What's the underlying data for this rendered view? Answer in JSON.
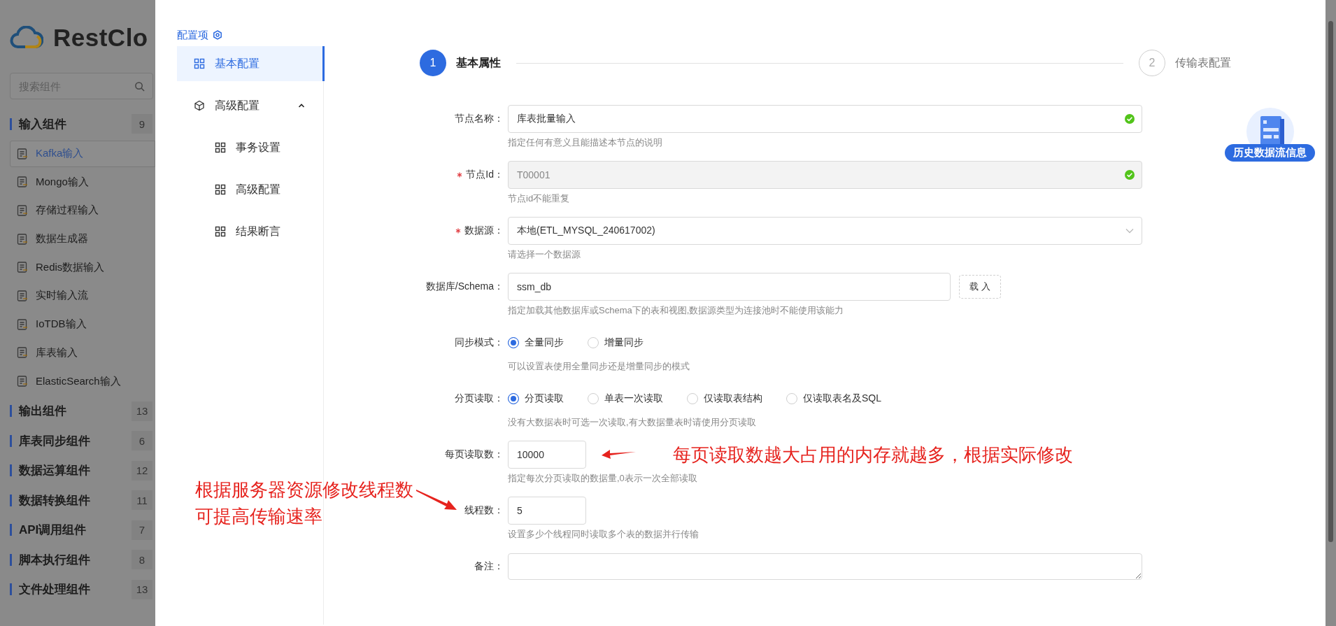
{
  "sidebar": {
    "logo": "RestClo",
    "search": {
      "placeholder": "搜索组件"
    },
    "categories": [
      {
        "label": "输入组件",
        "count": "9",
        "items": [
          {
            "label": "Kafka输入",
            "selected": true
          },
          {
            "label": "Mongo输入",
            "selected": false
          },
          {
            "label": "存储过程输入",
            "selected": false
          },
          {
            "label": "数据生成器",
            "selected": false
          },
          {
            "label": "Redis数据输入",
            "selected": false
          },
          {
            "label": "实时输入流",
            "selected": false
          },
          {
            "label": "IoTDB输入",
            "selected": false
          },
          {
            "label": "库表输入",
            "selected": false
          },
          {
            "label": "ElasticSearch输入",
            "selected": false
          }
        ]
      },
      {
        "label": "输出组件",
        "count": "13"
      },
      {
        "label": "库表同步组件",
        "count": "6"
      },
      {
        "label": "数据运算组件",
        "count": "12"
      },
      {
        "label": "数据转换组件",
        "count": "11"
      },
      {
        "label": "API调用组件",
        "count": "7"
      },
      {
        "label": "脚本执行组件",
        "count": "8"
      },
      {
        "label": "文件处理组件",
        "count": "13"
      }
    ]
  },
  "config_nav": {
    "title": "配置项",
    "items": [
      {
        "label": "基本配置",
        "selected": true
      },
      {
        "label": "高级配置",
        "selected": false,
        "expanded": true,
        "children": [
          {
            "label": "事务设置",
            "selected": false
          },
          {
            "label": "高级配置",
            "selected": false
          },
          {
            "label": "结果断言",
            "selected": false
          }
        ]
      }
    ]
  },
  "steps": [
    {
      "number": "1",
      "label": "基本属性",
      "active": true
    },
    {
      "number": "2",
      "label": "传输表配置",
      "active": false
    }
  ],
  "form": [
    {
      "kind": "text",
      "label": "节点名称：",
      "value": "库表批量输入",
      "valid": true,
      "disabled": false,
      "help": "指定任何有意义且能描述本节点的说明"
    },
    {
      "kind": "text",
      "label": "节点Id：",
      "required": true,
      "value": "T00001",
      "valid": true,
      "disabled": true,
      "help": "节点id不能重复"
    },
    {
      "kind": "select",
      "label": "数据源：",
      "required": true,
      "value": "本地(ETL_MYSQL_240617002)",
      "help": "请选择一个数据源"
    },
    {
      "kind": "text",
      "label": "数据库/Schema：",
      "value": "ssm_db",
      "disabled": false,
      "button": "载 入",
      "help": "指定加载其他数据库或Schema下的表和视图,数据源类型为连接池时不能使用该能力"
    },
    {
      "kind": "radio",
      "label": "同步模式：",
      "options": [
        {
          "label": "全量同步",
          "selected": true
        },
        {
          "label": "增量同步",
          "selected": false
        }
      ],
      "help": "可以设置表使用全量同步还是增量同步的模式"
    },
    {
      "kind": "radio",
      "label": "分页读取：",
      "options": [
        {
          "label": "分页读取",
          "selected": true
        },
        {
          "label": "单表一次读取",
          "selected": false
        },
        {
          "label": "仅读取表结构",
          "selected": false
        },
        {
          "label": "仅读取表名及SQL",
          "selected": false
        }
      ],
      "help": "没有大数据表时可选一次读取,有大数据量表时请使用分页读取"
    },
    {
      "kind": "number",
      "label": "每页读取数：",
      "value": "10000",
      "help": "指定每次分页读取的数据量,0表示一次全部读取",
      "note": "每页读取数越大占用的内存就越多，根据实际修改"
    },
    {
      "kind": "number",
      "label": "线程数：",
      "value": "5",
      "help": "设置多少个线程同时读取多个表的数据并行传输",
      "side_note": [
        "根据服务器资源修改线程数",
        "可提高传输速率"
      ]
    },
    {
      "kind": "textarea",
      "label": "备注："
    }
  ],
  "history_badge": {
    "label": "历史数据流信息"
  }
}
